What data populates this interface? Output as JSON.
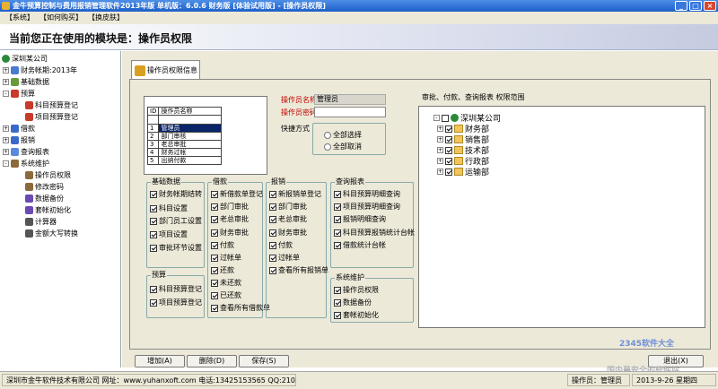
{
  "window": {
    "title": "金牛预算控制与费用报销管理软件2013年版 单机版：6.0.6 财务版 [体验试用版] - [操作员权限]"
  },
  "menu": [
    "【系统】",
    "【如何购买】",
    "【换皮肤】"
  ],
  "banner": "当前您正在使用的模块是：操作员权限",
  "tree": [
    {
      "label": "深圳某公司",
      "level": 0,
      "exp": ""
    },
    {
      "label": "财务帐期:2013年",
      "level": 1,
      "exp": "+"
    },
    {
      "label": "基础数据",
      "level": 1,
      "exp": "+"
    },
    {
      "label": "预算",
      "level": 1,
      "exp": "-"
    },
    {
      "label": "科目预算登记",
      "level": 2,
      "exp": ""
    },
    {
      "label": "项目预算登记",
      "level": 2,
      "exp": ""
    },
    {
      "label": "借款",
      "level": 1,
      "exp": "+"
    },
    {
      "label": "报销",
      "level": 1,
      "exp": "+"
    },
    {
      "label": "查询报表",
      "level": 1,
      "exp": "+"
    },
    {
      "label": "系统维护",
      "level": 1,
      "exp": "-"
    },
    {
      "label": "操作员权限",
      "level": 2,
      "exp": ""
    },
    {
      "label": "修改密码",
      "level": 2,
      "exp": ""
    },
    {
      "label": "数据备份",
      "level": 2,
      "exp": ""
    },
    {
      "label": "套帐初始化",
      "level": 2,
      "exp": ""
    },
    {
      "label": "计算器",
      "level": 2,
      "exp": ""
    },
    {
      "label": "金额大写转换",
      "level": 2,
      "exp": ""
    }
  ],
  "tab_label": "操作员权限信息",
  "operator_list": {
    "headers": [
      "ID",
      "操作员名称"
    ],
    "rows": [
      {
        "id": "1",
        "name": "管理员",
        "selected": true
      },
      {
        "id": "2",
        "name": "部门审核",
        "selected": false
      },
      {
        "id": "3",
        "name": "老总审批",
        "selected": false
      },
      {
        "id": "4",
        "name": "财务过帐",
        "selected": false
      },
      {
        "id": "5",
        "name": "出纳付款",
        "selected": false
      }
    ]
  },
  "fields": {
    "name_label": "操作员名称",
    "name_value": "管理员",
    "password_label": "操作员密码",
    "password_value": ""
  },
  "quick": {
    "label": "快捷方式",
    "select_all": "全部选择",
    "cancel_all": "全部取消"
  },
  "scope_label": "审批、付款、查询报表 权限范围",
  "groups": {
    "basic": {
      "title": "基础数据",
      "items": [
        "财务帐期结转",
        "科目设置",
        "部门员工设置",
        "项目设置",
        "审批环节设置"
      ]
    },
    "budget": {
      "title": "预算",
      "items": [
        "科目预算登记",
        "项目预算登记"
      ]
    },
    "loan": {
      "title": "借款",
      "items": [
        "新借款单登记",
        "部门审批",
        "老总审批",
        "财务审批",
        "付款",
        "过帐单",
        "还款",
        "未还款",
        "已还款",
        "查看所有借款单"
      ]
    },
    "expense": {
      "title": "报销",
      "items": [
        "新报销单登记",
        "部门审批",
        "老总审批",
        "财务审批",
        "付款",
        "过帐单",
        "查看所有报销单"
      ]
    },
    "report": {
      "title": "查询报表",
      "items": [
        "科目预算明细查询",
        "项目预算明细查询",
        "报销明细查询",
        "科目预算报销统计台帐",
        "借款统计台帐"
      ]
    },
    "maint": {
      "title": "系统维护",
      "items": [
        "操作员权限",
        "数据备份",
        "套帐初始化"
      ]
    }
  },
  "scope_tree": {
    "root": "深圳某公司",
    "children": [
      "财务部",
      "销售部",
      "技术部",
      "行政部",
      "运输部"
    ]
  },
  "buttons": {
    "add": "增加(A)",
    "delete": "删除(D)",
    "save": "保存(S)",
    "exit": "退出(X)"
  },
  "status": {
    "company": "深圳市金牛软件技术有限公司 网址：www.yuhanxoft.com 电话:13425153565 QQ:21035391",
    "operator_label": "操作员：",
    "operator": "管理员",
    "date": "2013-9-26 星期四"
  },
  "watermark": {
    "line1": "2345软件大全",
    "line2": "国内最安全的软件站"
  }
}
